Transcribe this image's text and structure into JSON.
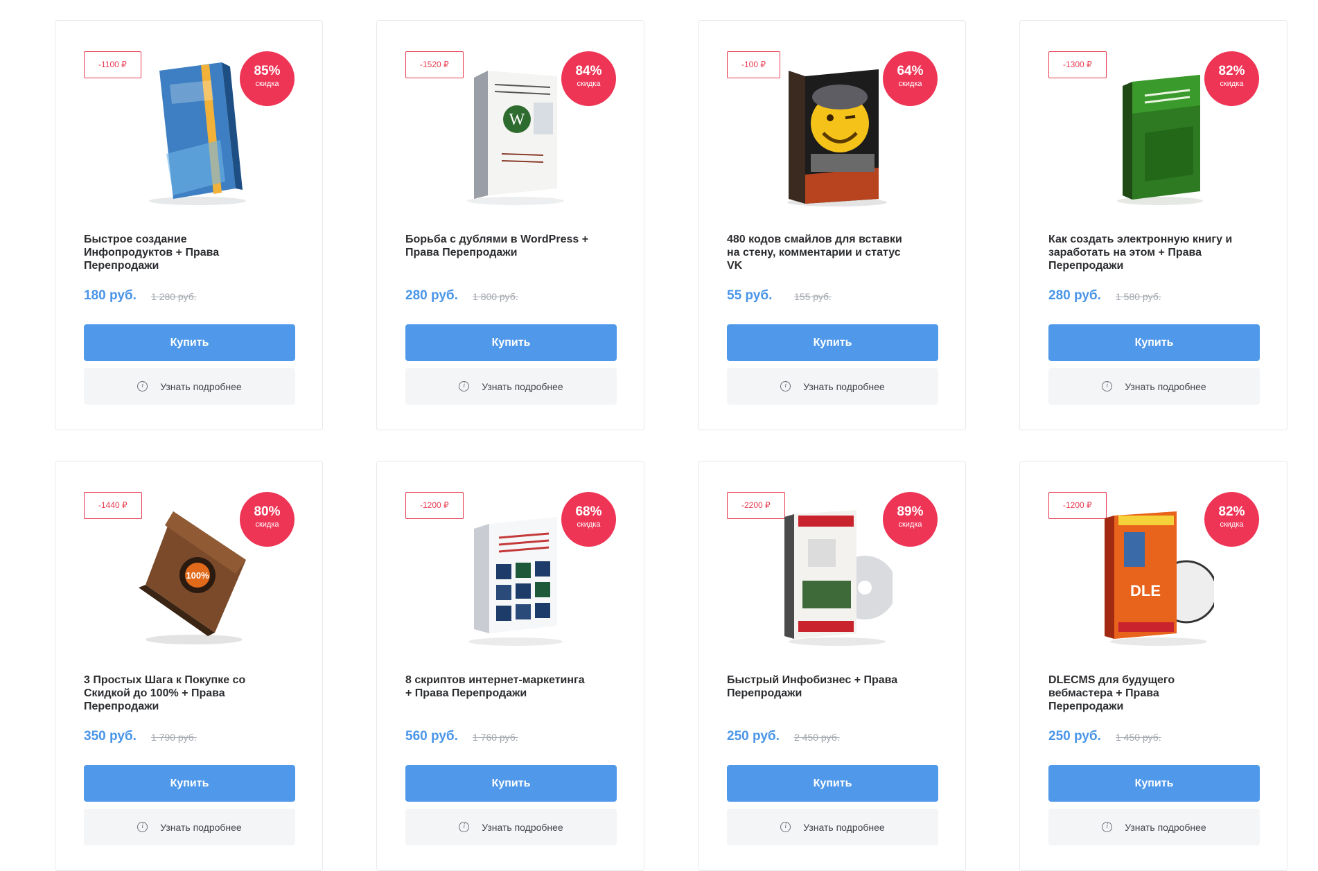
{
  "ui": {
    "discount_word": "скидка",
    "buy_label": "Купить",
    "more_label": "Узнать подробнее",
    "info_icon": "i"
  },
  "colors": {
    "accent_blue": "#5099ea",
    "price_blue": "#4a95e8",
    "badge_red": "#ee3556",
    "tag_red": "#e8394f"
  },
  "products": [
    {
      "off": "-1100 ₽",
      "pct": "85%",
      "title": "Быстрое создание Инфопродуктов + Права Перепродажи",
      "price": "180 руб.",
      "old": "1 280 руб.",
      "cover": "ebook-blue-cover-icon"
    },
    {
      "off": "-1520 ₽",
      "pct": "84%",
      "title": "Борьба с дублями в WordPress + Права Перепродажи",
      "price": "280 руб.",
      "old": "1 800 руб.",
      "cover": "software-box-icon"
    },
    {
      "off": "-100 ₽",
      "pct": "64%",
      "title": "480 кодов смайлов для вставки на стену, комментарии и статус VK",
      "price": "55 руб.",
      "old": "155 руб.",
      "cover": "smiley-box-icon"
    },
    {
      "off": "-1300 ₽",
      "pct": "82%",
      "title": "Как создать электронную книгу и заработать на этом + Права Перепродажи",
      "price": "280 руб.",
      "old": "1 580 руб.",
      "cover": "green-ebook-icon"
    },
    {
      "off": "-1440 ₽",
      "pct": "80%",
      "title": "3 Простых Шага к Покупке со Скидкой до 100% + Права Перепродажи",
      "price": "350 руб.",
      "old": "1 790 руб.",
      "cover": "brown-book-icon"
    },
    {
      "off": "-1200 ₽",
      "pct": "68%",
      "title": "8 скриптов интернет-маркетинга + Права Перепродажи",
      "price": "560 руб.",
      "old": "1 760 руб.",
      "cover": "scripts-box-icon"
    },
    {
      "off": "-2200 ₽",
      "pct": "89%",
      "title": "Быстрый Инфобизнес + Права Перепродажи",
      "price": "250 руб.",
      "old": "2 450 руб.",
      "cover": "dvd-box-icon"
    },
    {
      "off": "-1200 ₽",
      "pct": "82%",
      "title": "DLECMS для будущего вебмастера + Права Перепродажи",
      "price": "250 руб.",
      "old": "1 450 руб.",
      "cover": "dlecms-dvd-icon"
    }
  ]
}
